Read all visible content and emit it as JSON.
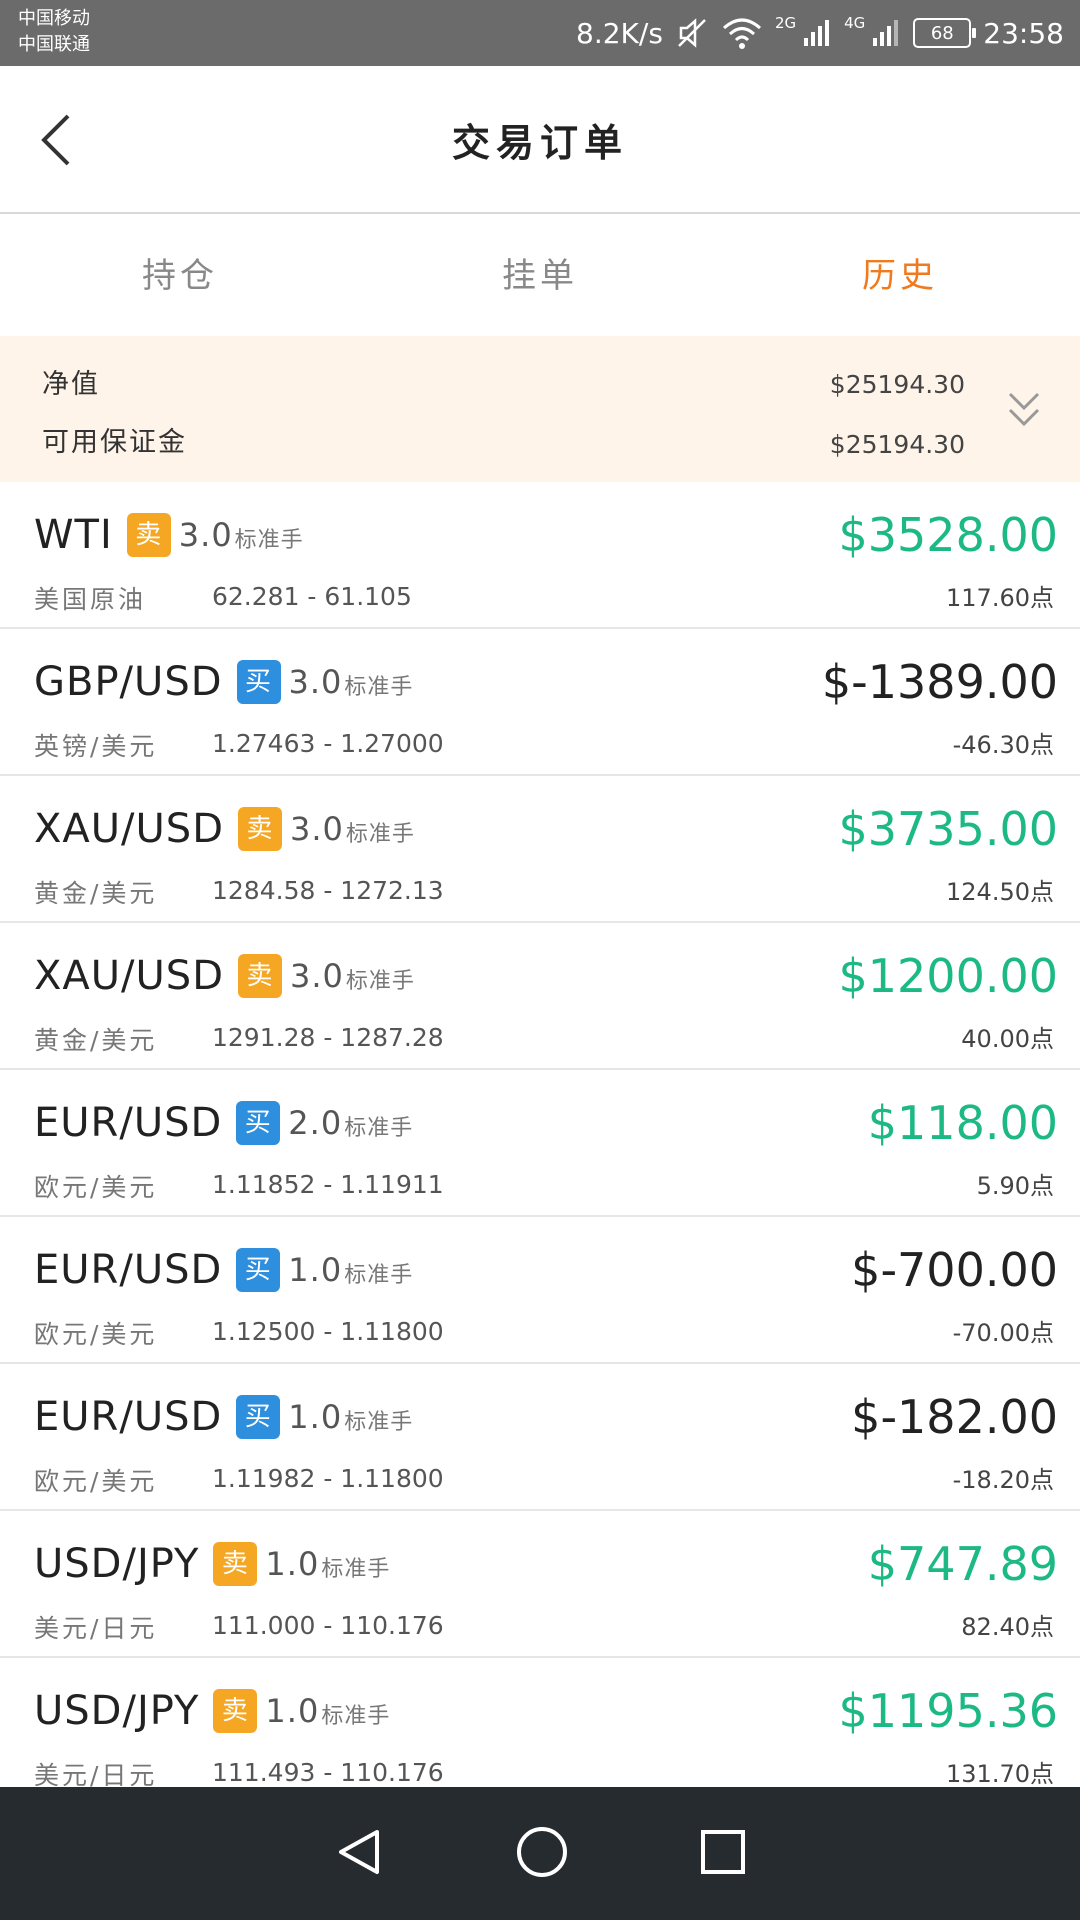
{
  "status_bar": {
    "carrier1": "中国移动",
    "carrier2": "中国联通",
    "speed": "8.2K/s",
    "net1": "2G",
    "net2": "4G",
    "battery": "68",
    "time": "23:58"
  },
  "header": {
    "title": "交易订单"
  },
  "tabs": [
    {
      "label": "持仓"
    },
    {
      "label": "挂单"
    },
    {
      "label": "历史"
    }
  ],
  "active_tab": "历史",
  "summary": {
    "net_label": "净值",
    "net_value": "$25194.30",
    "margin_label": "可用保证金",
    "margin_value": "$25194.30"
  },
  "orders": [
    {
      "symbol": "WTI",
      "side": "卖",
      "lot": "3.0",
      "unit": "标准手",
      "name": "美国原油",
      "range": "62.281 - 61.105",
      "profit": "$3528.00",
      "points": "117.60点"
    },
    {
      "symbol": "GBP/USD",
      "side": "买",
      "lot": "3.0",
      "unit": "标准手",
      "name": "英镑/美元",
      "range": "1.27463 - 1.27000",
      "profit": "$-1389.00",
      "points": "-46.30点"
    },
    {
      "symbol": "XAU/USD",
      "side": "卖",
      "lot": "3.0",
      "unit": "标准手",
      "name": "黄金/美元",
      "range": "1284.58 - 1272.13",
      "profit": "$3735.00",
      "points": "124.50点"
    },
    {
      "symbol": "XAU/USD",
      "side": "卖",
      "lot": "3.0",
      "unit": "标准手",
      "name": "黄金/美元",
      "range": "1291.28 - 1287.28",
      "profit": "$1200.00",
      "points": "40.00点"
    },
    {
      "symbol": "EUR/USD",
      "side": "买",
      "lot": "2.0",
      "unit": "标准手",
      "name": "欧元/美元",
      "range": "1.11852 - 1.11911",
      "profit": "$118.00",
      "points": "5.90点"
    },
    {
      "symbol": "EUR/USD",
      "side": "买",
      "lot": "1.0",
      "unit": "标准手",
      "name": "欧元/美元",
      "range": "1.12500 - 1.11800",
      "profit": "$-700.00",
      "points": "-70.00点"
    },
    {
      "symbol": "EUR/USD",
      "side": "买",
      "lot": "1.0",
      "unit": "标准手",
      "name": "欧元/美元",
      "range": "1.11982 - 1.11800",
      "profit": "$-182.00",
      "points": "-18.20点"
    },
    {
      "symbol": "USD/JPY",
      "side": "卖",
      "lot": "1.0",
      "unit": "标准手",
      "name": "美元/日元",
      "range": "111.000 - 110.176",
      "profit": "$747.89",
      "points": "82.40点"
    },
    {
      "symbol": "USD/JPY",
      "side": "卖",
      "lot": "1.0",
      "unit": "标准手",
      "name": "美元/日元",
      "range": "111.493 - 110.176",
      "profit": "$1195.36",
      "points": "131.70点"
    }
  ],
  "colors": {
    "accent": "#f07a1d",
    "profit_positive": "#1db985",
    "sell_badge": "#f5a623",
    "buy_badge": "#2d8fde",
    "summary_bg": "#fef4ea"
  },
  "icons": [
    "back-arrow-icon",
    "expand-chevrons-icon",
    "nav-back-icon",
    "nav-home-icon",
    "nav-recents-icon"
  ]
}
